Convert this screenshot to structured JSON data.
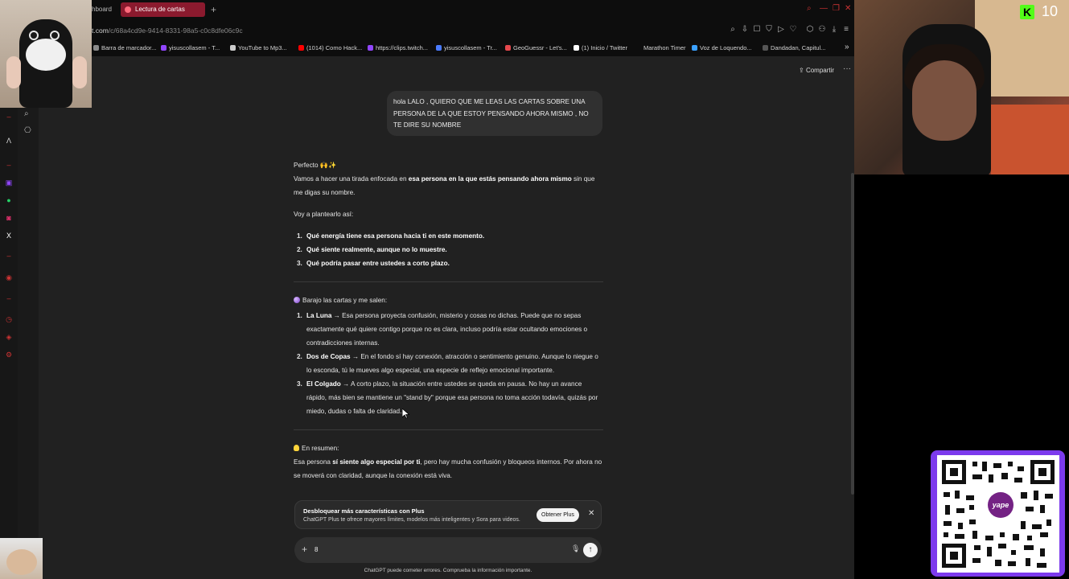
{
  "browser": {
    "tabs": [
      {
        "label": "hboard"
      },
      {
        "label": "Lectura de cartas"
      }
    ],
    "new_tab": "+",
    "url_domain": "t.com",
    "url_path": "/c/68a4cd9e-9414-8331-98a5-c0c8dfe06c9c",
    "bookmarks": [
      {
        "label": "Barra de marcador...",
        "color": "#8a8a8a"
      },
      {
        "label": "yisuscollasem - T...",
        "color": "#9146ff"
      },
      {
        "label": "YouTube to Mp3...",
        "color": "#cccccc"
      },
      {
        "label": "(1014) Como Hack...",
        "color": "#ff0000"
      },
      {
        "label": "https://clips.twitch...",
        "color": "#9146ff"
      },
      {
        "label": "yisuscollasem - Tr...",
        "color": "#4a7bff"
      },
      {
        "label": "GeoGuessr - Let's...",
        "color": "#e5484d"
      },
      {
        "label": "(1) Inicio / Twitter",
        "color": "#ffffff"
      },
      {
        "label": "Marathon Timer",
        "color": "#000000"
      },
      {
        "label": "Voz de Loquendo...",
        "color": "#3aa0ff"
      },
      {
        "label": "Dandadan, Capitul...",
        "color": "#555555"
      }
    ]
  },
  "chat": {
    "share_label": "Compartir",
    "user_message": "hola LALO , QUIERO QUE ME LEAS LAS CARTAS SOBRE UNA PERSONA DE LA QUE ESTOY PENSANDO AHORA MISMO , NO TE DIRE SU NOMBRE",
    "answer": {
      "intro_title": "Perfecto 🙌✨",
      "intro_pre": "Vamos a hacer una tirada enfocada en ",
      "intro_bold": "esa persona en la que estás pensando ahora mismo",
      "intro_post": " sin que me digas su nombre.",
      "plan_heading": "Voy a plantearlo así:",
      "plan_items": [
        "Qué energía tiene esa persona hacia ti en este momento.",
        "Qué siente realmente, aunque no lo muestre.",
        "Qué podría pasar entre ustedes a corto plazo."
      ],
      "cards_heading": "Barajo las cartas y me salen:",
      "cards": [
        {
          "name": "La Luna",
          "text": " → Esa persona proyecta confusión, misterio y cosas no dichas. Puede que no sepas exactamente qué quiere contigo porque no es clara, incluso podría estar ocultando emociones o contradicciones internas."
        },
        {
          "name": "Dos de Copas",
          "text": " → En el fondo sí hay conexión, atracción o sentimiento genuino. Aunque lo niegue o lo esconda, tú le mueves algo especial, una especie de reflejo emocional importante."
        },
        {
          "name": "El Colgado",
          "text": " → A corto plazo, la situación entre ustedes se queda en pausa. No hay un avance rápido, más bien se mantiene un \"stand by\" porque esa persona no toma acción todavía, quizás por miedo, dudas o falta de claridad."
        }
      ],
      "summary_heading": "En resumen:",
      "summary_pre": "Esa persona ",
      "summary_bold": "sí siente algo especial por ti",
      "summary_post": ", pero hay mucha confusión y bloqueos internos. Por ahora no se moverá con claridad, aunque la conexión está viva."
    },
    "plus_banner": {
      "title": "Desbloquear más características con Plus",
      "description": "ChatGPT Plus te ofrece mayores límites, modelos más inteligentes y Sora para videos.",
      "button": "Obtener Plus"
    },
    "composer_value": "8",
    "disclaimer": "ChatGPT puede cometer errores. Comprueba la información importante."
  },
  "stream": {
    "viewer_count": "10",
    "qr_logo_text": "yape",
    "accent_kick": "#53fc18",
    "accent_yape": "#742284"
  }
}
